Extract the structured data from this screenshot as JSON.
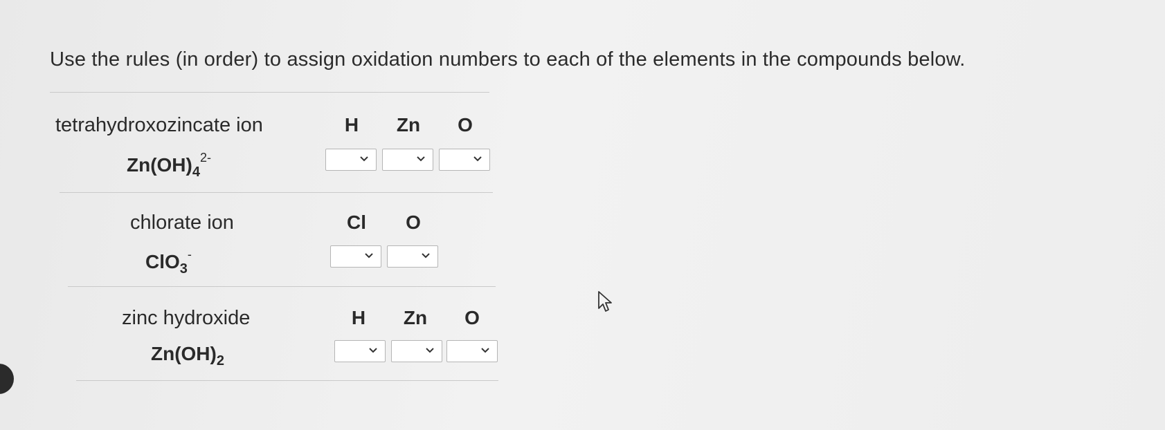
{
  "instructions": "Use the rules (in order) to assign oxidation numbers to each of the elements in the compounds below.",
  "compounds": [
    {
      "name": "tetrahydroxozincate ion",
      "formula_main": "Zn(OH)",
      "formula_sub": "4",
      "formula_sup": "2-",
      "elements": [
        "H",
        "Zn",
        "O"
      ],
      "selected": [
        "",
        "",
        ""
      ]
    },
    {
      "name": "chlorate ion",
      "formula_main": "ClO",
      "formula_sub": "3",
      "formula_sup": "-",
      "elements": [
        "Cl",
        "O"
      ],
      "selected": [
        "",
        ""
      ]
    },
    {
      "name": "zinc hydroxide",
      "formula_main": "Zn(OH)",
      "formula_sub": "2",
      "formula_sup": "",
      "elements": [
        "H",
        "Zn",
        "O"
      ],
      "selected": [
        "",
        "",
        ""
      ]
    }
  ],
  "icons": {
    "dropdown": "chevron-down-icon",
    "cursor": "mouse-pointer-icon"
  }
}
